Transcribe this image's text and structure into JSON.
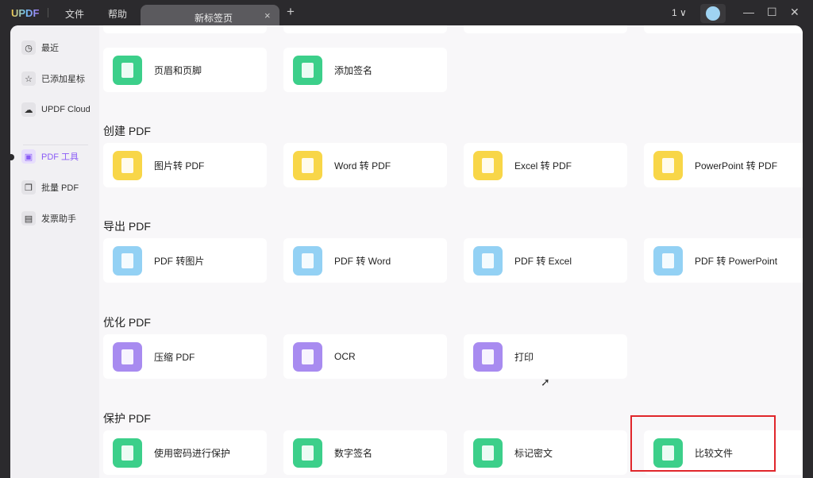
{
  "titlebar": {
    "logo": "UPDF",
    "menu": [
      "文件",
      "帮助"
    ],
    "tab": "新标签页",
    "tab_close": "×",
    "new_tab": "+",
    "page_count": "1",
    "page_chevron": "∨",
    "minimize": "—",
    "maximize": "☐",
    "close": "✕"
  },
  "sidebar": {
    "items": [
      {
        "label": "最近",
        "icon": "clock-icon",
        "glyph": "◷"
      },
      {
        "label": "已添加星标",
        "icon": "star-icon",
        "glyph": "☆"
      },
      {
        "label": "UPDF Cloud",
        "icon": "cloud-icon",
        "glyph": "☁"
      },
      {
        "label": "PDF 工具",
        "icon": "toolbox-icon",
        "glyph": "▣"
      },
      {
        "label": "批量 PDF",
        "icon": "batch-icon",
        "glyph": "❐"
      },
      {
        "label": "发票助手",
        "icon": "invoice-icon",
        "glyph": "▤"
      }
    ]
  },
  "sections": [
    {
      "title": "",
      "tools": [
        "页眉和页脚",
        "添加签名"
      ]
    },
    {
      "title": "创建 PDF",
      "tools": [
        "图片转 PDF",
        "Word 转 PDF",
        "Excel 转 PDF",
        "PowerPoint 转 PDF"
      ]
    },
    {
      "title": "导出 PDF",
      "tools": [
        "PDF 转图片",
        "PDF 转 Word",
        "PDF 转 Excel",
        "PDF 转 PowerPoint"
      ]
    },
    {
      "title": "优化 PDF",
      "tools": [
        "压缩 PDF",
        "OCR",
        "打印"
      ]
    },
    {
      "title": "保护 PDF",
      "tools": [
        "使用密码进行保护",
        "数字签名",
        "标记密文",
        "比较文件"
      ]
    }
  ],
  "colors": {
    "green": "#3ccf8a",
    "yellow": "#f8d648",
    "blue": "#93d1f4",
    "purple": "#a88bf0",
    "highlight": "#e0262b"
  }
}
